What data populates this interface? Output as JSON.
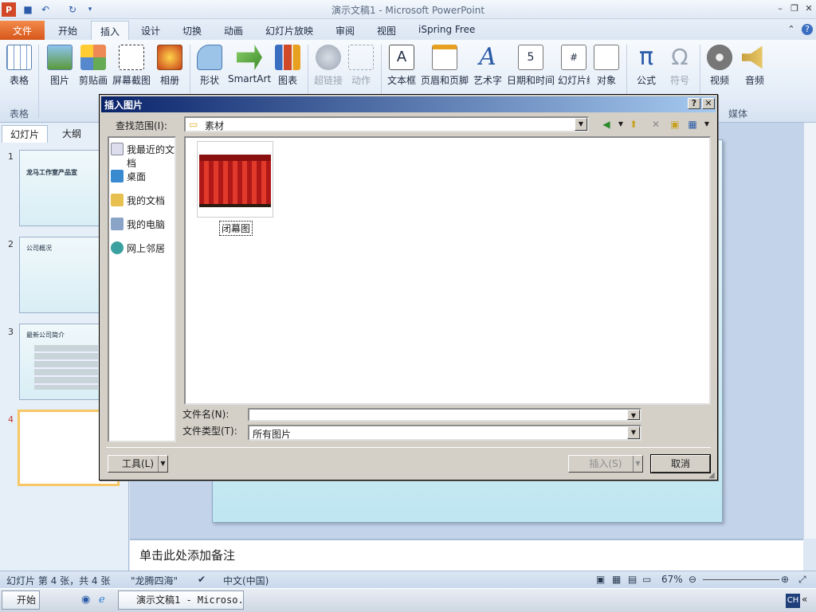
{
  "app": {
    "title": "演示文稿1 - Microsoft PowerPoint"
  },
  "ribbon": {
    "tabs": [
      "文件",
      "开始",
      "插入",
      "设计",
      "切换",
      "动画",
      "幻灯片放映",
      "审阅",
      "视图",
      "iSpring Free"
    ],
    "buttons": [
      "表格",
      "图片",
      "剪贴画",
      "屏幕截图",
      "相册",
      "形状",
      "SmartArt",
      "图表",
      "超链接",
      "动作",
      "文本框",
      "页眉和页脚",
      "艺术字",
      "日期和时间",
      "幻灯片编号",
      "对象",
      "公式",
      "符号",
      "视频",
      "音频"
    ],
    "groups": [
      "表格",
      "媒体"
    ]
  },
  "leftpane": {
    "tabs": [
      "幻灯片",
      "大纲"
    ],
    "slides": [
      "1",
      "2",
      "3",
      "4"
    ],
    "thumb_titles": [
      "龙马工作室产品宣",
      "公司概况",
      "最新公司简介"
    ]
  },
  "dialog": {
    "title": "插入图片",
    "help": "?",
    "close": "✕",
    "lookin_label": "查找范围(I):",
    "lookin_value": "素材",
    "places": [
      "我最近的文档",
      "桌面",
      "我的文档",
      "我的电脑",
      "网上邻居"
    ],
    "file": {
      "name": "闭幕图"
    },
    "filename_label": "文件名(N):",
    "filename_value": "",
    "filetype_label": "文件类型(T):",
    "filetype_value": "所有图片",
    "tools_label": "工具(L)",
    "insert_label": "插入(S)",
    "cancel_label": "取消"
  },
  "notes": {
    "placeholder": "单击此处添加备注"
  },
  "status": {
    "slide_info": "幻灯片 第 4 张，共 4 张",
    "theme": "\"龙腾四海\"",
    "language": "中文(中国)",
    "zoom": "67%"
  },
  "taskbar": {
    "start": "开始",
    "window": "演示文稿1 - Microso...",
    "ime": "CH"
  }
}
